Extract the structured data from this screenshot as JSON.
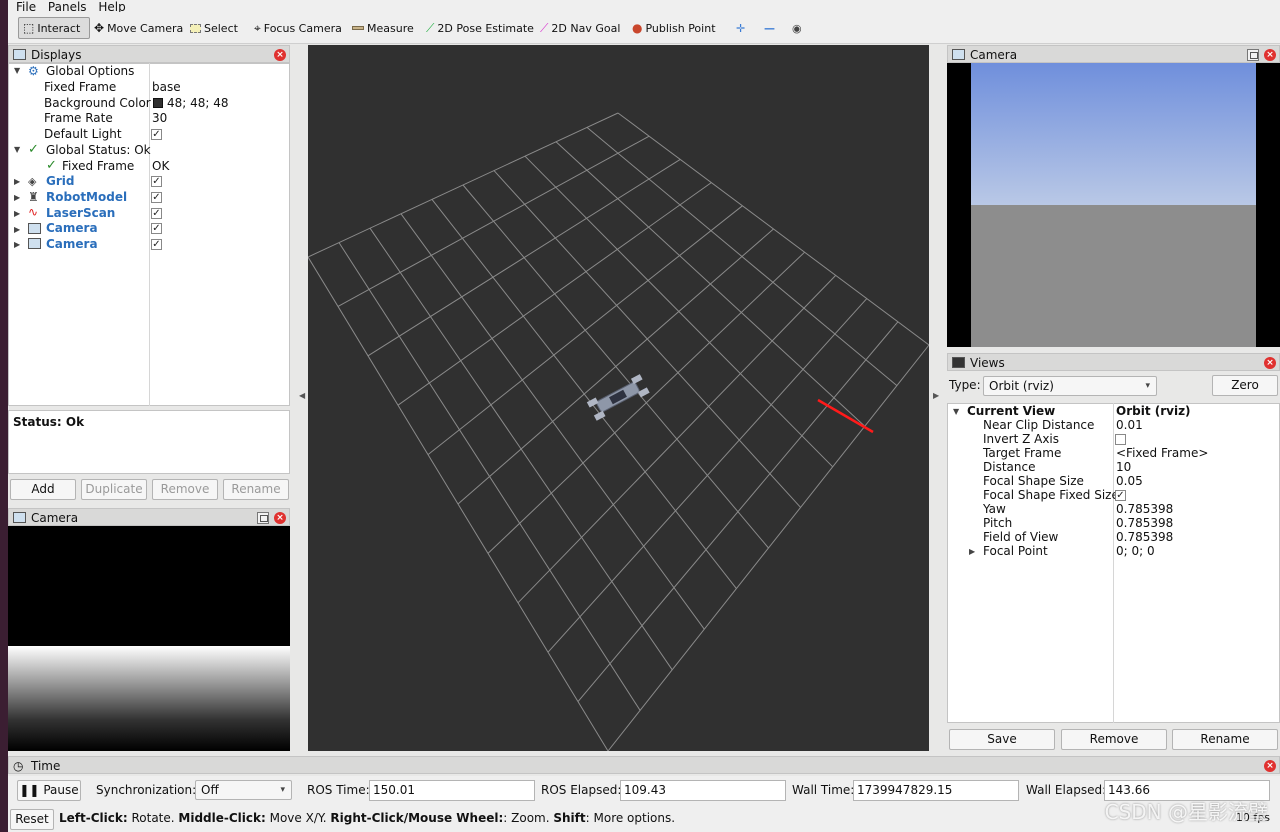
{
  "menu": [
    "File",
    "Panels",
    "Help"
  ],
  "toolbar": {
    "tools": [
      {
        "label": "Interact",
        "icon": "cursor-icon"
      },
      {
        "label": "Move Camera",
        "icon": "move-icon"
      },
      {
        "label": "Select",
        "icon": "select-icon"
      },
      {
        "label": "Focus Camera",
        "icon": "focus-icon"
      },
      {
        "label": "Measure",
        "icon": "ruler-icon"
      },
      {
        "label": "2D Pose Estimate",
        "icon": "pose-arrow-icon"
      },
      {
        "label": "2D Nav Goal",
        "icon": "nav-arrow-icon"
      },
      {
        "label": "Publish Point",
        "icon": "pin-icon"
      }
    ],
    "extra_glyphs": [
      "✛",
      "—",
      "◉"
    ]
  },
  "displays": {
    "title": "Displays",
    "global_options": {
      "label": "Global Options",
      "fixed_frame_label": "Fixed Frame",
      "fixed_frame": "base",
      "bg_label": "Background Color",
      "bg_value": "48; 48; 48",
      "frame_rate_label": "Frame Rate",
      "frame_rate": "30",
      "default_light_label": "Default Light"
    },
    "global_status": {
      "label": "Global Status: Ok",
      "child_label": "Fixed Frame",
      "child_value": "OK"
    },
    "items": [
      {
        "label": "Grid"
      },
      {
        "label": "RobotModel"
      },
      {
        "label": "LaserScan"
      },
      {
        "label": "Camera"
      },
      {
        "label": "Camera"
      }
    ]
  },
  "status": {
    "text": "Status: Ok"
  },
  "display_buttons": {
    "add": "Add",
    "duplicate": "Duplicate",
    "remove": "Remove",
    "rename": "Rename"
  },
  "camera_left": {
    "title": "Camera"
  },
  "camera_right": {
    "title": "Camera"
  },
  "views": {
    "title": "Views",
    "type_label": "Type:",
    "type_value": "Orbit (rviz)",
    "zero": "Zero",
    "current_view": "Current View",
    "current_value": "Orbit (rviz)",
    "rows": [
      {
        "label": "Near Clip Distance",
        "value": "0.01"
      },
      {
        "label": "Invert Z Axis",
        "value": ""
      },
      {
        "label": "Target Frame",
        "value": "<Fixed Frame>"
      },
      {
        "label": "Distance",
        "value": "10"
      },
      {
        "label": "Focal Shape Size",
        "value": "0.05"
      },
      {
        "label": "Focal Shape Fixed Size",
        "value": ""
      },
      {
        "label": "Yaw",
        "value": "0.785398"
      },
      {
        "label": "Pitch",
        "value": "0.785398"
      },
      {
        "label": "Field of View",
        "value": "0.785398"
      },
      {
        "label": "Focal Point",
        "value": "0; 0; 0"
      }
    ],
    "save": "Save",
    "remove": "Remove",
    "rename": "Rename"
  },
  "time": {
    "title": "Time",
    "pause": "Pause",
    "sync_label": "Synchronization:",
    "sync_value": "Off",
    "ros_time_label": "ROS Time:",
    "ros_time": "150.01",
    "ros_elapsed_label": "ROS Elapsed:",
    "ros_elapsed": "109.43",
    "wall_time_label": "Wall Time:",
    "wall_time": "1739947829.15",
    "wall_elapsed_label": "Wall Elapsed:",
    "wall_elapsed": "143.66"
  },
  "hint": {
    "reset": "Reset",
    "b1": "Left-Click:",
    "t1": " Rotate. ",
    "b2": "Middle-Click:",
    "t2": " Move X/Y. ",
    "b3": "Right-Click/Mouse Wheel:",
    "t3": ": Zoom. ",
    "b4": "Shift",
    "t4": ": More options.",
    "fps": "10 fps"
  },
  "watermark": "CSDN @星影流璧",
  "colors": {
    "background": "#303030",
    "grid": "#8a8a8a",
    "laser": "#ff1a1a",
    "accent": "#2a6ebb"
  }
}
